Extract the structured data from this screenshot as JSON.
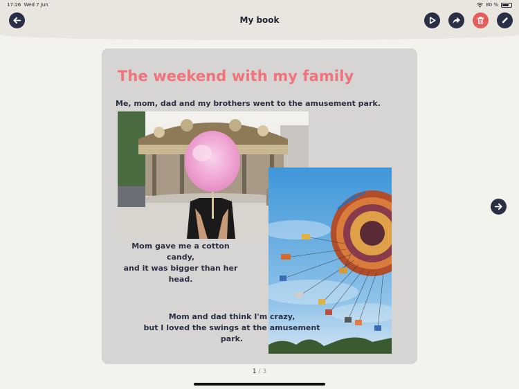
{
  "status": {
    "time": "17:26",
    "date": "Wed 7 Jun",
    "battery": "80 %",
    "battery_level": 0.8
  },
  "header": {
    "title": "My book"
  },
  "page": {
    "title": "The weekend with my family",
    "caption_top": "Me, mom, dad and my brothers went to the amusement park.",
    "caption_middle_line1": "Mom gave me a cotton candy,",
    "caption_middle_line2": "and it was bigger than her head.",
    "caption_bottom_line1": "Mom and dad think I'm crazy,",
    "caption_bottom_line2": "but I loved the swings at the amusement park."
  },
  "pager": {
    "current": "1",
    "separator": "/",
    "total": "3"
  },
  "icons": {
    "back": "arrow-left-icon",
    "play": "play-icon",
    "share": "share-arrow-icon",
    "delete": "trash-icon",
    "edit": "pencil-icon",
    "next": "arrow-right-icon"
  },
  "colors": {
    "accent": "#f0727b",
    "button": "#2b2f45",
    "delete": "#e35d5d",
    "card": "#d6d5d3",
    "background": "#f3f2ec"
  }
}
